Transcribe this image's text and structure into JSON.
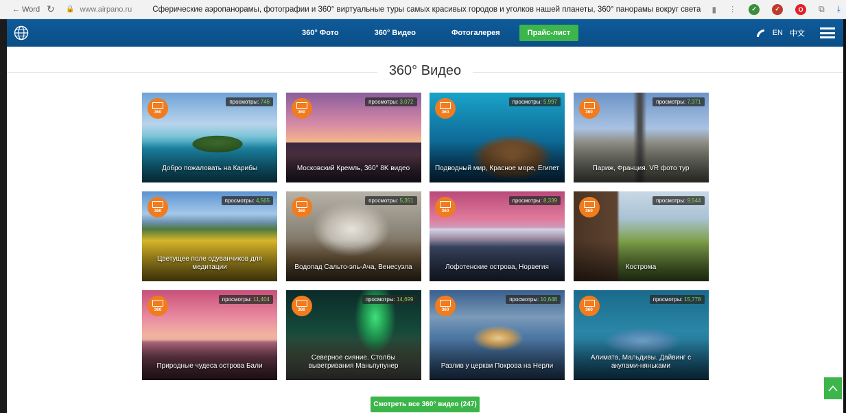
{
  "browser": {
    "back_label": "Word",
    "url": "www.airpano.ru",
    "page_title": "Сферические аэропанорамы, фотографии и 360° виртуальные туры самых красивых городов и уголков нашей планеты, 360° панорамы вокруг света",
    "icons": [
      "back-arrow-icon",
      "reload-icon",
      "lock-icon",
      "bookmark-icon",
      "menu-dots-icon",
      "extension-icon",
      "opera-icon",
      "download-icon"
    ]
  },
  "header": {
    "nav": [
      "360° Фото",
      "360° Видео",
      "Фотогалерея"
    ],
    "price_label": "Прайс-лист",
    "lang_en": "EN",
    "lang_zh": "中文",
    "icons": [
      "globe-icon",
      "phone-icon",
      "hamburger-icon"
    ],
    "brand_color": "#0e5b9a",
    "accent_color": "#3cb54a"
  },
  "section": {
    "title": "360° Видео"
  },
  "views_label": "просмотры:",
  "badge_label": "360",
  "cards": [
    {
      "title": "Добро пожаловать на Карибы",
      "views": "746"
    },
    {
      "title": "Московский Кремль, 360° 8K видео",
      "views": "3,072"
    },
    {
      "title": "Подводный мир, Красное море, Египет",
      "views": "5,997"
    },
    {
      "title": "Париж, Франция. VR фото тур",
      "views": "7,371"
    },
    {
      "title": "Цветущее поле одуванчиков для медитации",
      "views": "4,565"
    },
    {
      "title": "Водопад Сальто-эль-Ача, Венесуэла",
      "views": "5,351"
    },
    {
      "title": "Лофотенские острова, Норвегия",
      "views": "8,339"
    },
    {
      "title": "Кострома",
      "views": "9,544"
    },
    {
      "title": "Природные чудеса острова Бали",
      "views": "11,404"
    },
    {
      "title": "Северное сияние. Столбы выветривания Маньпупунер",
      "views": "14,699"
    },
    {
      "title": "Разлив у церкви Покрова на Нерли",
      "views": "10,648"
    },
    {
      "title": "Алимата, Мальдивы. Дайвинг с акулами-няньками",
      "views": "15,778"
    }
  ],
  "more_button": "Смотреть все 360° видео (247)"
}
